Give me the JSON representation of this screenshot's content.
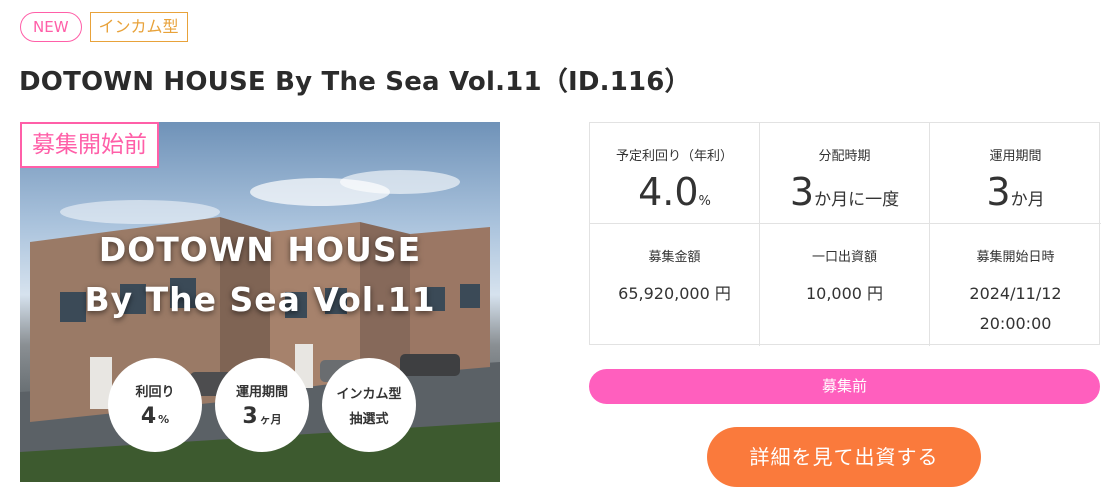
{
  "tags": {
    "new": "NEW",
    "type": "インカム型"
  },
  "title": "DOTOWN HOUSE By The Sea Vol.11（ID.116）",
  "hero": {
    "status": "募集開始前",
    "line1": "DOTOWN HOUSE",
    "line2": "By The Sea Vol.11",
    "badges": [
      {
        "label": "利回り",
        "value": "4",
        "unit": "%"
      },
      {
        "label": "運用期間",
        "value": "3",
        "unit": "ヶ月"
      },
      {
        "label": "インカム型",
        "sub": "抽選式"
      }
    ]
  },
  "stats": {
    "yield": {
      "label": "予定利回り（年利）",
      "value": "4.0",
      "unit": "%"
    },
    "distribution": {
      "label": "分配時期",
      "value": "3",
      "unit": "か月に一度"
    },
    "period": {
      "label": "運用期間",
      "value": "3",
      "unit": "か月"
    },
    "amount": {
      "label": "募集金額",
      "value": "65,920,000 円"
    },
    "unit_price": {
      "label": "一口出資額",
      "value": "10,000 円"
    },
    "start": {
      "label": "募集開始日時",
      "date": "2024/11/12",
      "time": "20:00:00"
    }
  },
  "status_bar": "募集前",
  "cta": "詳細を見て出資する",
  "colors": {
    "pink": "#ff5fa8",
    "orange": "#fa7a3c",
    "gold": "#e8a23a"
  }
}
